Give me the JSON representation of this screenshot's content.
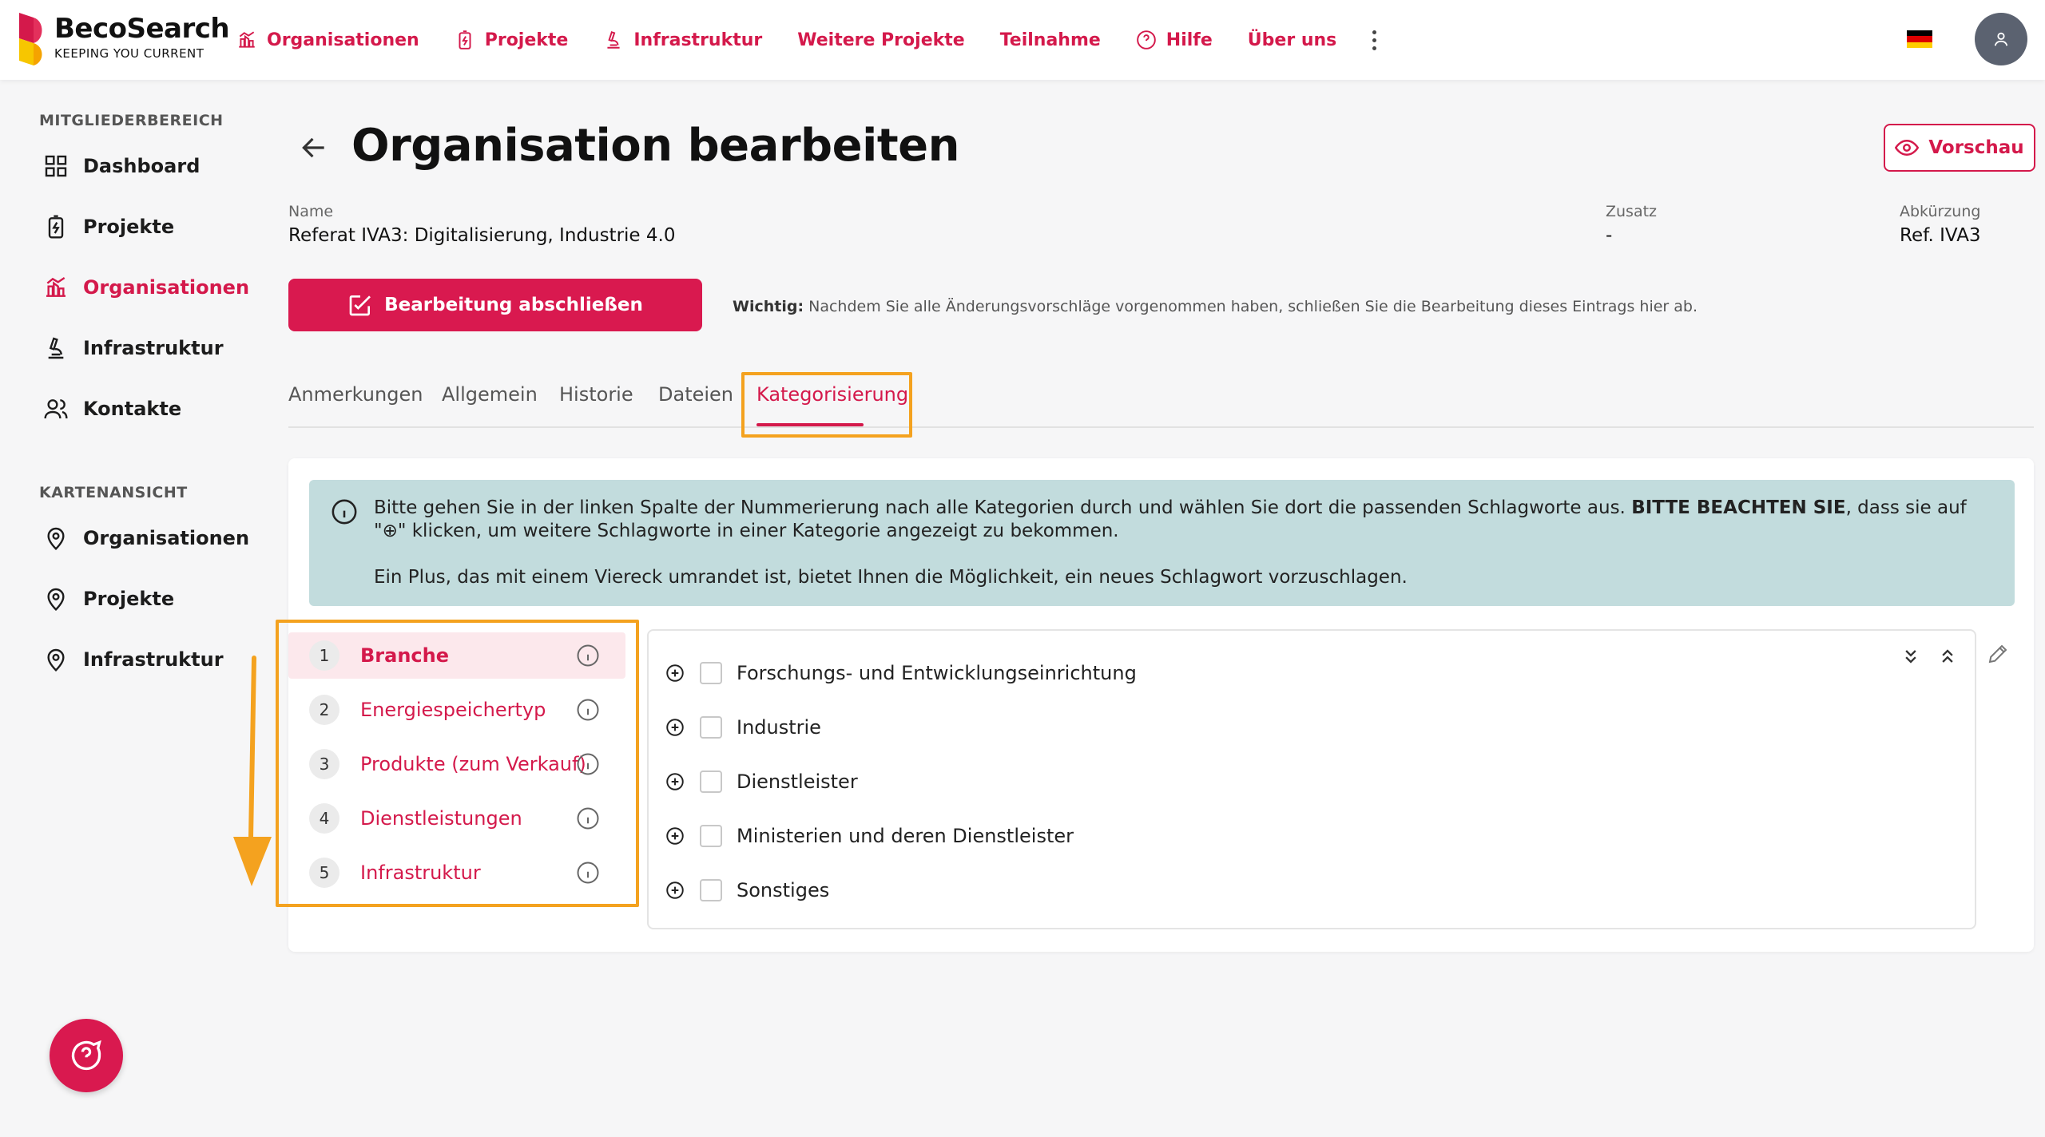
{
  "logo": {
    "name": "BecoSearch",
    "tagline": "KEEPING YOU CURRENT"
  },
  "topnav": {
    "items": [
      {
        "label": "Organisationen",
        "icon": "chart-building-icon"
      },
      {
        "label": "Projekte",
        "icon": "battery-icon"
      },
      {
        "label": "Infrastruktur",
        "icon": "microscope-icon"
      },
      {
        "label": "Weitere Projekte",
        "icon": ""
      },
      {
        "label": "Teilnahme",
        "icon": ""
      },
      {
        "label": "Hilfe",
        "icon": "question-circle-icon"
      },
      {
        "label": "Über uns",
        "icon": ""
      }
    ],
    "language": "de",
    "flag_colors": [
      "#000000",
      "#dd0000",
      "#ffce00"
    ]
  },
  "sidebar": {
    "member_heading": "MITGLIEDERBEREICH",
    "member_items": [
      {
        "label": "Dashboard",
        "icon": "grid-icon",
        "active": false
      },
      {
        "label": "Projekte",
        "icon": "battery-icon",
        "active": false
      },
      {
        "label": "Organisationen",
        "icon": "chart-building-icon",
        "active": true
      },
      {
        "label": "Infrastruktur",
        "icon": "microscope-icon",
        "active": false
      },
      {
        "label": "Kontakte",
        "icon": "users-icon",
        "active": false
      }
    ],
    "map_heading": "KARTENANSICHT",
    "map_items": [
      {
        "label": "Organisationen",
        "icon": "map-pin-icon"
      },
      {
        "label": "Projekte",
        "icon": "map-pin-icon"
      },
      {
        "label": "Infrastruktur",
        "icon": "map-pin-icon"
      }
    ]
  },
  "page": {
    "title": "Organisation bearbeiten",
    "preview_label": "Vorschau",
    "fields": {
      "name_label": "Name",
      "name_value": "Referat IVA3: Digitalisierung, Industrie 4.0",
      "zusatz_label": "Zusatz",
      "zusatz_value": "-",
      "abk_label": "Abkürzung",
      "abk_value": "Ref. IVA3"
    },
    "finish_label": "Bearbeitung abschließen",
    "important_bold": "Wichtig:",
    "important_text": " Nachdem Sie alle Änderungsvorschläge vorgenommen haben, schließen Sie die Bearbeitung dieses Eintrags hier ab."
  },
  "tabs": [
    "Anmerkungen",
    "Allgemein",
    "Historie",
    "Dateien",
    "Kategorisierung"
  ],
  "active_tab": "Kategorisierung",
  "info": {
    "line1_a": "Bitte gehen Sie in der linken Spalte der Nummerierung nach alle Kategorien durch und wählen Sie dort die passenden Schlagworte aus. ",
    "line1_bold": "BITTE BEACHTEN SIE",
    "line1_b": ", dass sie auf \"⊕\" klicken, um weitere Schlagworte in einer Kategorie angezeigt zu bekommen.",
    "line2": "Ein Plus, das mit einem Viereck umrandet ist, bietet Ihnen die Möglichkeit, ein neues Schlagwort vorzuschlagen."
  },
  "categories": [
    {
      "num": "1",
      "label": "Branche",
      "active": true
    },
    {
      "num": "2",
      "label": "Energiespeichertyp",
      "active": false
    },
    {
      "num": "3",
      "label": "Produkte (zum Verkauf)",
      "active": false
    },
    {
      "num": "4",
      "label": "Dienstleistungen",
      "active": false
    },
    {
      "num": "5",
      "label": "Infrastruktur",
      "active": false
    }
  ],
  "keywords": [
    {
      "label": "Forschungs- und Entwicklungseinrichtung",
      "checked": false
    },
    {
      "label": "Industrie",
      "checked": false
    },
    {
      "label": "Dienstleister",
      "checked": false
    },
    {
      "label": "Ministerien und deren Dienstleister",
      "checked": false
    },
    {
      "label": "Sonstiges",
      "checked": false
    }
  ],
  "colors": {
    "brand": "#d4194b",
    "highlight": "#f4a21f",
    "info_bg": "#c2dcdd"
  }
}
